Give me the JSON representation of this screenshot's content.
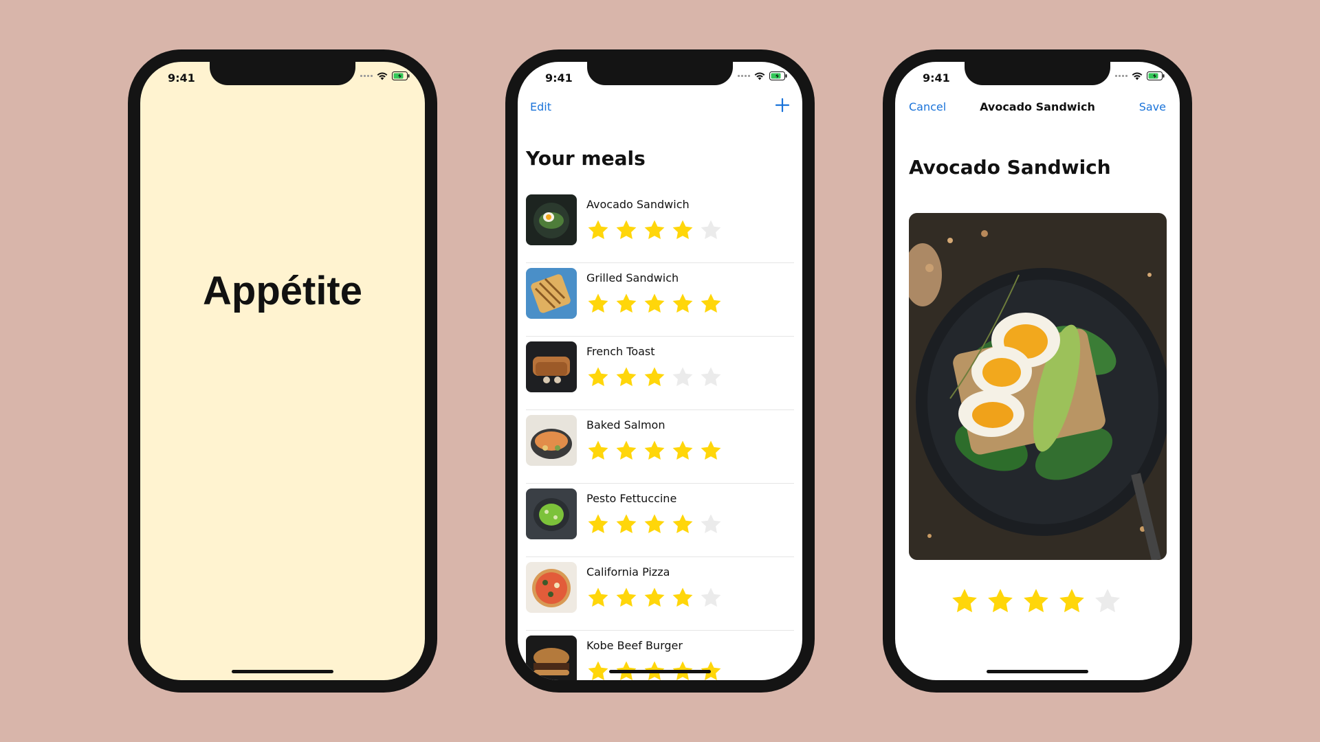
{
  "colors": {
    "background": "#d8b5aa",
    "splash_background": "#fff3d0",
    "accent_blue": "#1a73d9",
    "star_filled": "#ffd60a",
    "star_empty": "#ebebeb"
  },
  "status_bar": {
    "time": "9:41"
  },
  "splash": {
    "title": "Appétite"
  },
  "meal_list": {
    "edit_label": "Edit",
    "add_icon": "plus-icon",
    "title": "Your meals",
    "meals": [
      {
        "name": "Avocado Sandwich",
        "rating": 4,
        "thumb": "avocado-toast-photo"
      },
      {
        "name": "Grilled Sandwich",
        "rating": 5,
        "thumb": "grilled-sandwich-photo"
      },
      {
        "name": "French Toast",
        "rating": 3,
        "thumb": "french-toast-photo"
      },
      {
        "name": "Baked Salmon",
        "rating": 5,
        "thumb": "baked-salmon-photo"
      },
      {
        "name": "Pesto Fettuccine",
        "rating": 4,
        "thumb": "pesto-fettuccine-photo"
      },
      {
        "name": "California Pizza",
        "rating": 4,
        "thumb": "pizza-photo"
      },
      {
        "name": "Kobe Beef Burger",
        "rating": 5,
        "thumb": "burger-photo"
      }
    ]
  },
  "meal_detail": {
    "cancel_label": "Cancel",
    "nav_title": "Avocado Sandwich",
    "save_label": "Save",
    "title": "Avocado Sandwich",
    "rating": 4,
    "photo": "avocado-sandwich-photo"
  }
}
